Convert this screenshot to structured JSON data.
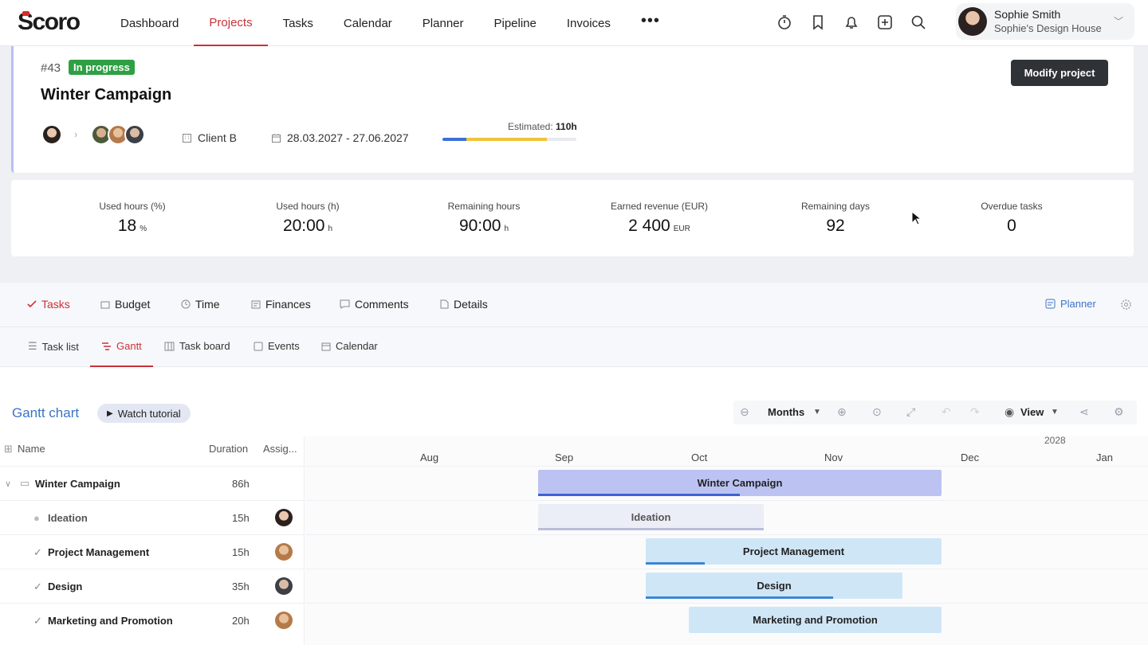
{
  "app": {
    "brand": "Scoro"
  },
  "nav": {
    "items": [
      "Dashboard",
      "Projects",
      "Tasks",
      "Calendar",
      "Planner",
      "Pipeline",
      "Invoices"
    ],
    "active": "Projects",
    "more": "•••"
  },
  "user": {
    "name": "Sophie Smith",
    "company": "Sophie's Design House"
  },
  "project": {
    "id": "#43",
    "status": "In progress",
    "title": "Winter Campaign",
    "client": "Client B",
    "dates": "28.03.2027 - 27.06.2027",
    "estimated_label": "Estimated:",
    "estimated_value": "110h",
    "progress_used_fraction": 0.18,
    "progress_planned_fraction": 0.78,
    "modify_label": "Modify project"
  },
  "stats": [
    {
      "label": "Used hours (%)",
      "value": "18",
      "unit": "%"
    },
    {
      "label": "Used hours (h)",
      "value": "20:00",
      "unit": "h"
    },
    {
      "label": "Remaining hours",
      "value": "90:00",
      "unit": "h"
    },
    {
      "label": "Earned revenue (EUR)",
      "value": "2 400",
      "unit": "EUR"
    },
    {
      "label": "Remaining days",
      "value": "92",
      "unit": ""
    },
    {
      "label": "Overdue tasks",
      "value": "0",
      "unit": ""
    }
  ],
  "tabs": [
    "Tasks",
    "Budget",
    "Time",
    "Finances",
    "Comments",
    "Details"
  ],
  "tabs_active": "Tasks",
  "planner_link": "Planner",
  "subtabs": [
    "Task list",
    "Gantt",
    "Task board",
    "Events",
    "Calendar"
  ],
  "subtabs_active": "Gantt",
  "gantt": {
    "title": "Gantt chart",
    "watch": "Watch tutorial",
    "scale": "Months",
    "view": "View",
    "columns": {
      "name": "Name",
      "duration": "Duration",
      "assignee": "Assig..."
    },
    "year_label": "2028",
    "months": [
      "Aug",
      "Sep",
      "Oct",
      "Nov",
      "Dec",
      "Jan"
    ],
    "rows": [
      {
        "name": "Winter Campaign",
        "duration": "86h"
      },
      {
        "name": "Ideation",
        "duration": "15h"
      },
      {
        "name": "Project Management",
        "duration": "15h"
      },
      {
        "name": "Design",
        "duration": "35h"
      },
      {
        "name": "Marketing and Promotion",
        "duration": "20h"
      }
    ],
    "bars": [
      {
        "label": "Winter Campaign",
        "progress": 0.5,
        "color": "#bcc2f2",
        "prog_color": "#3d63d4"
      },
      {
        "label": "Ideation",
        "progress": 1.0,
        "color": "#eceef7",
        "prog_color": "#b8bdd9"
      },
      {
        "label": "Project Management",
        "progress": 0.2,
        "color": "#cfe6f7",
        "prog_color": "#3a86d4"
      },
      {
        "label": "Design",
        "progress": 0.73,
        "color": "#cfe6f7",
        "prog_color": "#3a86d4"
      },
      {
        "label": "Marketing and Promotion",
        "progress": 0.0,
        "color": "#cfe6f7",
        "prog_color": "#3a86d4"
      }
    ]
  },
  "colors": {
    "accent": "#c9323a",
    "link": "#3a74c6",
    "status_green": "#2ea043"
  }
}
